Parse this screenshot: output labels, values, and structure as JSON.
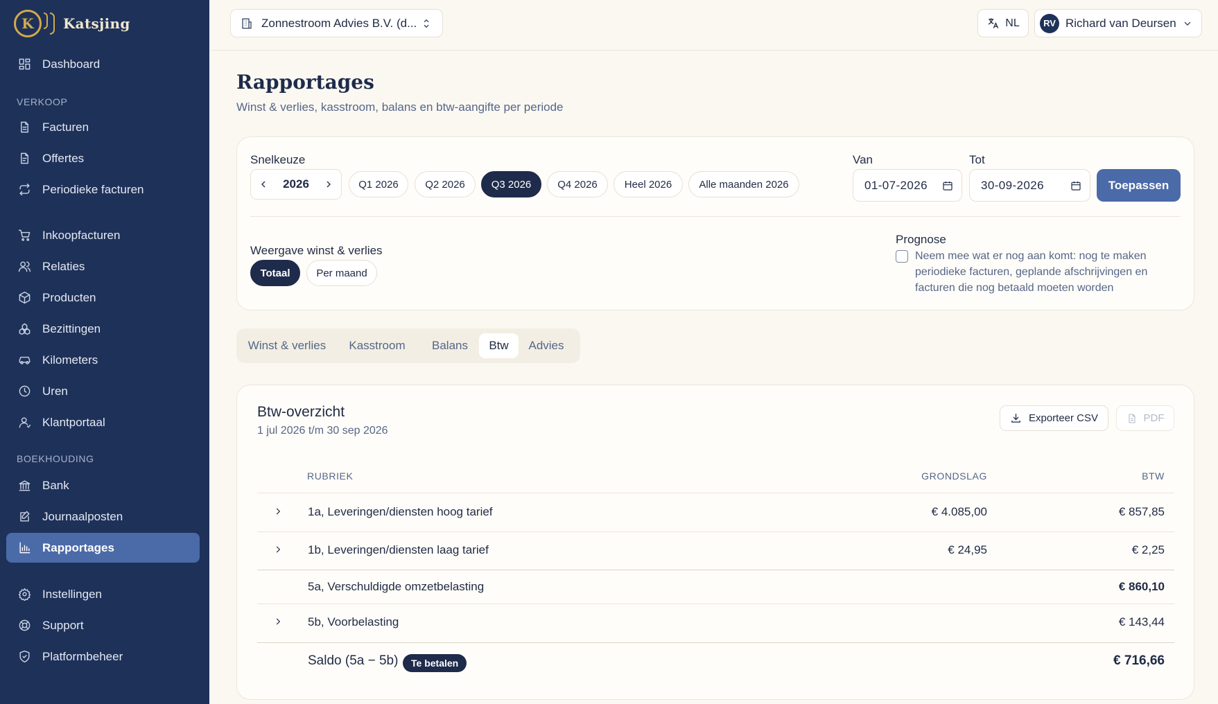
{
  "brand": {
    "name": "Katsjing",
    "mark": "K"
  },
  "sidebar": {
    "dashboard": "Dashboard",
    "sections": {
      "sales": "VERKOOP",
      "accounting": "BOEKHOUDING"
    },
    "items": [
      {
        "label": "Facturen",
        "icon": "invoice-icon"
      },
      {
        "label": "Offertes",
        "icon": "quote-icon"
      },
      {
        "label": "Periodieke facturen",
        "icon": "repeat-icon"
      },
      {
        "label": "Inkoopfacturen",
        "icon": "cart-icon"
      },
      {
        "label": "Relaties",
        "icon": "users-icon"
      },
      {
        "label": "Producten",
        "icon": "box-icon"
      },
      {
        "label": "Bezittingen",
        "icon": "assets-icon"
      },
      {
        "label": "Kilometers",
        "icon": "car-icon"
      },
      {
        "label": "Uren",
        "icon": "clock-icon"
      },
      {
        "label": "Klantportaal",
        "icon": "user-icon"
      },
      {
        "label": "Bank",
        "icon": "bank-icon"
      },
      {
        "label": "Journaalposten",
        "icon": "journal-icon"
      },
      {
        "label": "Rapportages",
        "icon": "chart-icon",
        "active": true
      },
      {
        "label": "Instellingen",
        "icon": "gear-icon"
      },
      {
        "label": "Support",
        "icon": "lifebuoy-icon"
      },
      {
        "label": "Platformbeheer",
        "icon": "shield-icon"
      }
    ]
  },
  "topbar": {
    "organization": "Zonnestroom Advies B.V. (d...",
    "language": "NL",
    "user_initials": "RV",
    "user_name": "Richard van Deursen"
  },
  "page": {
    "title": "Rapportages",
    "subtitle": "Winst & verlies, kasstroom, balans en btw-aangifte per periode"
  },
  "filters": {
    "quick_label": "Snelkeuze",
    "year": "2026",
    "quick_options": [
      "Q1 2026",
      "Q2 2026",
      "Q3 2026",
      "Q4 2026",
      "Heel 2026",
      "Alle maanden 2026"
    ],
    "quick_selected": "Q3 2026",
    "from_label": "Van",
    "from_value": "01-07-2026",
    "to_label": "Tot",
    "to_value": "30-09-2026",
    "apply_label": "Toepassen",
    "view_label": "Weergave winst & verlies",
    "view_options": [
      "Totaal",
      "Per maand"
    ],
    "view_selected": "Totaal",
    "forecast_label": "Prognose",
    "forecast_text": "Neem mee wat er nog aan komt: nog te maken periodieke facturen, geplande afschrijvingen en facturen die nog betaald moeten worden",
    "forecast_checked": false
  },
  "tabs": {
    "items": [
      "Winst & verlies",
      "Kasstroom",
      "Balans",
      "Btw",
      "Advies"
    ],
    "active": "Btw"
  },
  "vat": {
    "title": "Btw-overzicht",
    "period": "1 jul 2026 t/m 30 sep 2026",
    "export_csv": "Exporteer CSV",
    "pdf": "PDF",
    "headers": {
      "category": "RUBRIEK",
      "base": "GRONDSLAG",
      "vat": "BTW"
    },
    "rows": [
      {
        "category": "1a, Leveringen/diensten hoog tarief",
        "base": "€ 4.085,00",
        "vat": "€ 857,85",
        "expandable": true
      },
      {
        "category": "1b, Leveringen/diensten laag tarief",
        "base": "€ 24,95",
        "vat": "€ 2,25",
        "expandable": true
      },
      {
        "category": "5a, Verschuldigde omzetbelasting",
        "base": "",
        "vat": "€ 860,10",
        "expandable": false
      },
      {
        "category": "5b, Voorbelasting",
        "base": "",
        "vat": "€ 143,44",
        "expandable": true
      }
    ],
    "balance": {
      "label": "Saldo (5a − 5b)",
      "badge": "Te betalen",
      "vat": "€ 716,66"
    }
  }
}
